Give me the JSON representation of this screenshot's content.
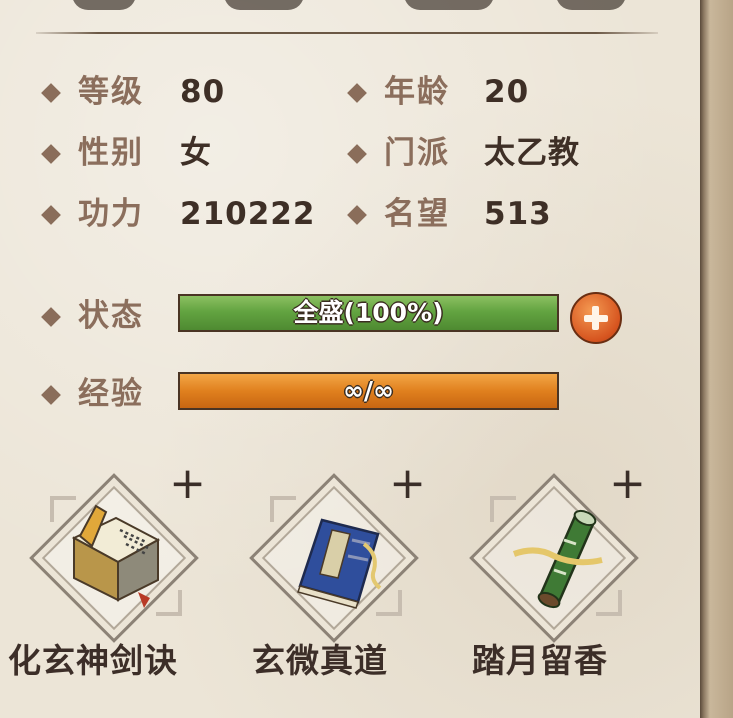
{
  "stats": {
    "level_label": "等级",
    "level_value": "80",
    "age_label": "年龄",
    "age_value": "20",
    "gender_label": "性别",
    "gender_value": "女",
    "sect_label": "门派",
    "sect_value": "太乙教",
    "power_label": "功力",
    "power_value": "210222",
    "fame_label": "名望",
    "fame_value": "513"
  },
  "status": {
    "label": "状态",
    "text": "全盛(100%)",
    "percent": 100
  },
  "experience": {
    "label": "经验",
    "text": "∞/∞",
    "percent": 100
  },
  "skills": [
    {
      "name": "化玄神剑诀",
      "icon": "golden-book-icon"
    },
    {
      "name": "玄微真道",
      "icon": "blue-book-icon"
    },
    {
      "name": "踏月留香",
      "icon": "green-scroll-icon"
    }
  ],
  "colors": {
    "label": "#8b6e5c",
    "value": "#3e2f26",
    "status_bar": "#63a441",
    "exp_bar": "#e0801e",
    "add_button": "#d6541f"
  }
}
